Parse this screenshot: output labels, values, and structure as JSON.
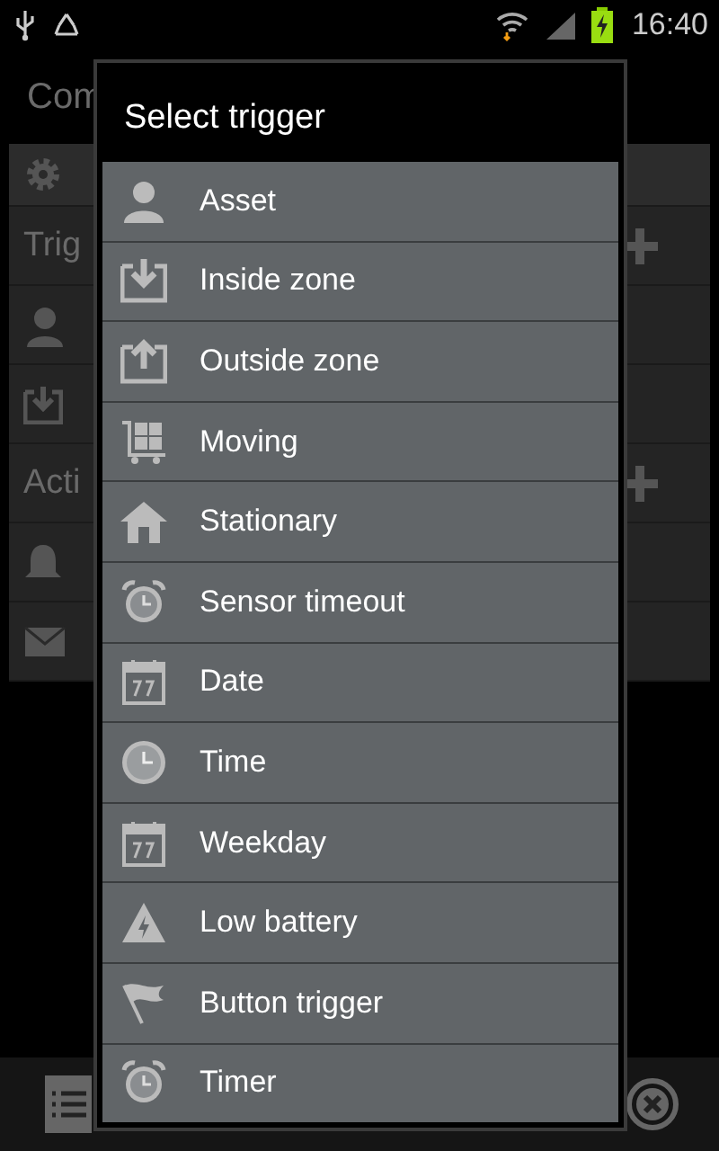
{
  "status_bar": {
    "time": "16:40"
  },
  "background": {
    "title": "Com",
    "sections": [
      {
        "label": "Trig"
      },
      {
        "label": "Acti"
      }
    ]
  },
  "dialog": {
    "title": "Select trigger",
    "items": [
      {
        "label": "Asset"
      },
      {
        "label": "Inside zone"
      },
      {
        "label": "Outside zone"
      },
      {
        "label": "Moving"
      },
      {
        "label": "Stationary"
      },
      {
        "label": "Sensor timeout"
      },
      {
        "label": "Date"
      },
      {
        "label": "Time"
      },
      {
        "label": "Weekday"
      },
      {
        "label": "Low battery"
      },
      {
        "label": "Button trigger"
      },
      {
        "label": "Timer"
      }
    ]
  }
}
